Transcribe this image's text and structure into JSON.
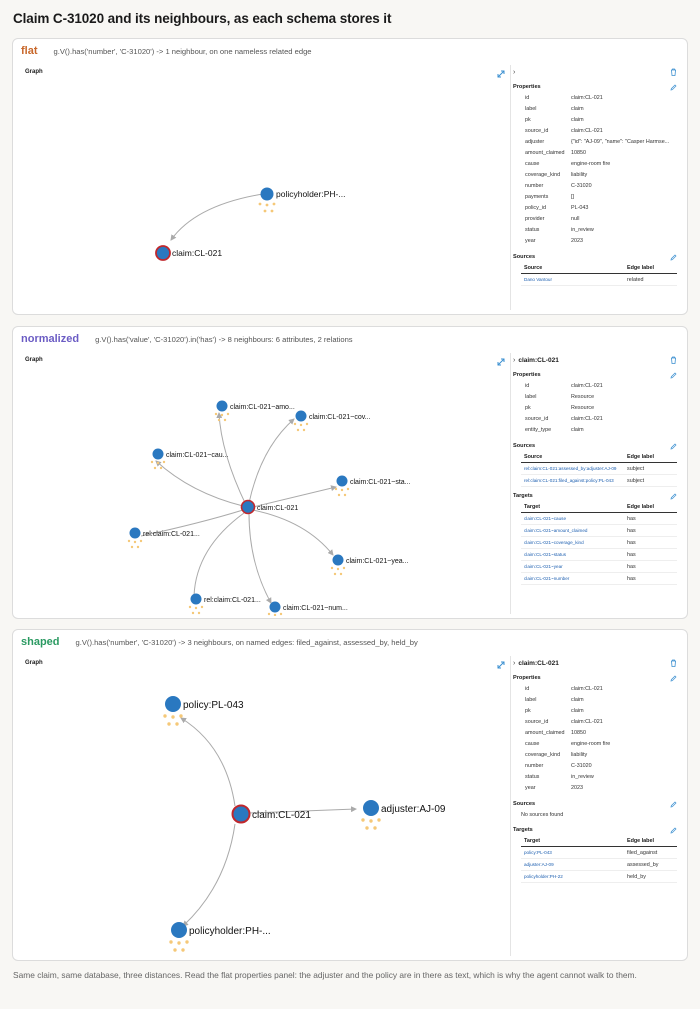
{
  "page": {
    "title": "Claim C-31020 and its neighbours, as each schema stores it",
    "footer": "Same claim, same database, three distances. Read the flat properties panel: the adjuster and the policy are in there as text, which is why the agent cannot walk to them."
  },
  "colors": {
    "flat": "#c8672a",
    "normalized": "#6b5cc4",
    "shaped": "#2b9a62",
    "node": "#2a78c0",
    "focus_ring": "#c0282d",
    "edge": "#aaaaaa",
    "link": "#1d5fb0"
  },
  "panels": [
    {
      "schema": "flat",
      "query": "g.V().has('number', 'C-31020')   ->   1 neighbour, on one nameless related edge",
      "graph_label": "Graph",
      "nodes": [
        "policyholder:PH-...",
        "claim:CL-021"
      ],
      "selected_node": "",
      "properties_label": "Properties",
      "properties": [
        {
          "k": "id",
          "v": "claim:CL-021"
        },
        {
          "k": "label",
          "v": "claim"
        },
        {
          "k": "pk",
          "v": "claim"
        },
        {
          "k": "source_id",
          "v": "claim:CL-021"
        },
        {
          "k": "adjuster",
          "v": "{\"id\": \"AJ-09\", \"name\": \"Casper Harmse..."
        },
        {
          "k": "amount_claimed",
          "v": "10850"
        },
        {
          "k": "cause",
          "v": "engine-room fire"
        },
        {
          "k": "coverage_kind",
          "v": "liability"
        },
        {
          "k": "number",
          "v": "C-31020"
        },
        {
          "k": "payments",
          "v": "[]"
        },
        {
          "k": "policy_id",
          "v": "PL-043"
        },
        {
          "k": "provider",
          "v": "null"
        },
        {
          "k": "status",
          "v": "in_review"
        },
        {
          "k": "year",
          "v": "2023"
        }
      ],
      "sources_label": "Sources",
      "sources_cols": [
        "Source",
        "Edge label"
      ],
      "sources": [
        {
          "a": "Dano Vantour",
          "b": "related"
        }
      ]
    },
    {
      "schema": "normalized",
      "query": "g.V().has('value', 'C-31020').in('has')   ->   8 neighbours: 6 attributes, 2 relations",
      "graph_label": "Graph",
      "nodes": [
        "claim:CL-021",
        "claim:CL-021~amo...",
        "claim:CL-021~cov...",
        "claim:CL-021~cau...",
        "claim:CL-021~sta...",
        "rel:claim:CL-021...",
        "claim:CL-021~yea...",
        "rel:claim:CL-021...",
        "claim:CL-021~num..."
      ],
      "selected_node": "claim:CL-021",
      "properties_label": "Properties",
      "properties": [
        {
          "k": "id",
          "v": "claim:CL-021"
        },
        {
          "k": "label",
          "v": "Resource"
        },
        {
          "k": "pk",
          "v": "Resource"
        },
        {
          "k": "source_id",
          "v": "claim:CL-021"
        },
        {
          "k": "entity_type",
          "v": "claim"
        }
      ],
      "sources_label": "Sources",
      "sources_cols": [
        "Source",
        "Edge label"
      ],
      "sources": [
        {
          "a": "rel:claim:CL-021:assessed_by:adjuster:AJ-09",
          "b": "subject"
        },
        {
          "a": "rel:claim:CL-021:filed_against:policy:PL-043",
          "b": "subject"
        }
      ],
      "targets_label": "Targets",
      "targets_cols": [
        "Target",
        "Edge label"
      ],
      "targets": [
        {
          "a": "claim:CL-021~cause",
          "b": "has"
        },
        {
          "a": "claim:CL-021~amount_claimed",
          "b": "has"
        },
        {
          "a": "claim:CL-021~coverage_kind",
          "b": "has"
        },
        {
          "a": "claim:CL-021~status",
          "b": "has"
        },
        {
          "a": "claim:CL-021~year",
          "b": "has"
        },
        {
          "a": "claim:CL-021~number",
          "b": "has"
        }
      ]
    },
    {
      "schema": "shaped",
      "query": "g.V().has('number', 'C-31020')   ->   3 neighbours, on named edges: filed_against, assessed_by, held_by",
      "graph_label": "Graph",
      "nodes": [
        "policy:PL-043",
        "claim:CL-021",
        "adjuster:AJ-09",
        "policyholder:PH-..."
      ],
      "selected_node": "claim:CL-021",
      "properties_label": "Properties",
      "properties": [
        {
          "k": "id",
          "v": "claim:CL-021"
        },
        {
          "k": "label",
          "v": "claim"
        },
        {
          "k": "pk",
          "v": "claim"
        },
        {
          "k": "source_id",
          "v": "claim:CL-021"
        },
        {
          "k": "amount_claimed",
          "v": "10850"
        },
        {
          "k": "cause",
          "v": "engine-room fire"
        },
        {
          "k": "coverage_kind",
          "v": "liability"
        },
        {
          "k": "number",
          "v": "C-31020"
        },
        {
          "k": "status",
          "v": "in_review"
        },
        {
          "k": "year",
          "v": "2023"
        }
      ],
      "sources_label": "Sources",
      "sources_empty": "No sources found",
      "sources": [],
      "targets_label": "Targets",
      "targets_cols": [
        "Target",
        "Edge label"
      ],
      "targets": [
        {
          "a": "policy:PL-043",
          "b": "filed_against"
        },
        {
          "a": "adjuster:AJ-09",
          "b": "assessed_by"
        },
        {
          "a": "policyholder:PH-22",
          "b": "held_by"
        }
      ]
    }
  ]
}
